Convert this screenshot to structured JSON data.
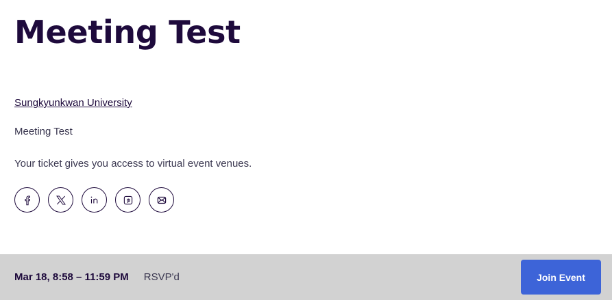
{
  "event": {
    "title": "Meeting Test",
    "organizer": "Sungkyunkwan University",
    "subtitle": "Meeting Test",
    "ticket_note": "Your ticket gives you access to virtual event venues."
  },
  "share": {
    "icons": [
      "facebook-icon",
      "x-twitter-icon",
      "linkedin-icon",
      "pinterest-icon",
      "email-icon"
    ]
  },
  "footer": {
    "date": "Mar 18, 8:58 – 11:59 PM",
    "status": "RSVP'd",
    "join_label": "Join Event",
    "join_color": "#3d64d8"
  }
}
